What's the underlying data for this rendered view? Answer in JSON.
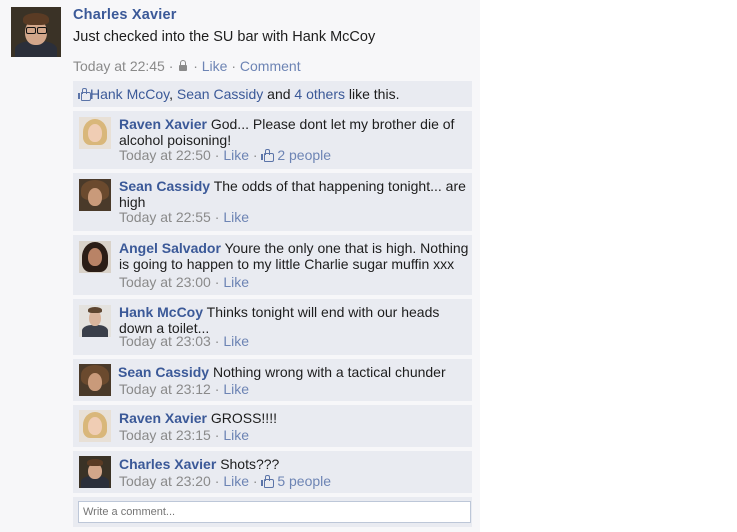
{
  "post": {
    "author": "Charles Xavier",
    "text": "Just checked into the SU bar with Hank McCoy",
    "time": "Today at 22:45",
    "sep1": " · ",
    "sep2": " · ",
    "sep3": " · ",
    "like_label": "Like",
    "comment_label": "Comment",
    "privacy_icon": "lock-icon"
  },
  "likes_bar": {
    "icon": "thumbs-up-icon",
    "name1": "Hank McCoy",
    "comma": ", ",
    "name2": "Sean Cassidy",
    "and": " and ",
    "others": "4 others",
    "suffix": " like this."
  },
  "comments": [
    {
      "author": "Raven Xavier",
      "text": "God... Please dont let my brother die of alcohol poisoning!",
      "time": "Today at 22:50",
      "like_label": "Like",
      "likes": "2 people"
    },
    {
      "author": "Sean Cassidy",
      "text": "The odds of that happening tonight... are high",
      "time": "Today at 22:55",
      "like_label": "Like"
    },
    {
      "author": "Angel Salvador",
      "text": "Youre the only one that is high. Nothing is going to happen to my little Charlie sugar muffin xxx",
      "time": "Today at 23:00",
      "like_label": "Like"
    },
    {
      "author": "Hank McCoy",
      "text": "Thinks tonight will end with our heads down a toilet...",
      "time": "Today at 23:03",
      "like_label": "Like"
    },
    {
      "author": "Sean Cassidy",
      "text": " Nothing wrong with a tactical chunder",
      "time": "Today at 23:12",
      "like_label": "Like"
    },
    {
      "author": "Raven Xavier",
      "text": "GROSS!!!!",
      "time": "Today at 23:15",
      "like_label": "Like"
    },
    {
      "author": "Charles Xavier",
      "text": "Shots???",
      "time": "Today at 23:20",
      "like_label": "Like",
      "likes": "5 people"
    }
  ],
  "write_comment": {
    "placeholder": "Write a comment..."
  },
  "colors": {
    "link": "#3b5998",
    "meta": "#8a8a8a",
    "comment_bg": "#e9ebf1"
  }
}
